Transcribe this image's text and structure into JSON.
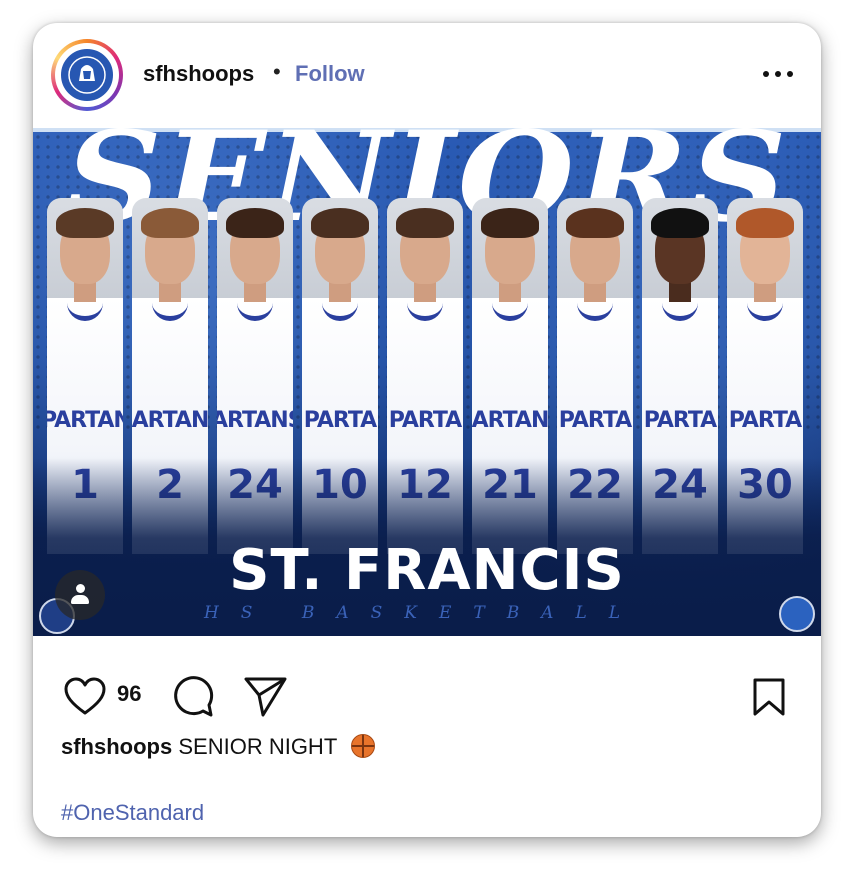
{
  "header": {
    "username": "sfhshoops",
    "separator": "•",
    "follow_label": "Follow",
    "avatar_icon": "team-logo",
    "more_icon": "more-horizontal-icon"
  },
  "image": {
    "headline": "SENIORS",
    "school_name": "ST. FRANCIS",
    "subtitle": "HS BASKETBALL",
    "players": [
      {
        "team": "PARTAN",
        "number": "1"
      },
      {
        "team": "ARTAN",
        "number": "2"
      },
      {
        "team": "ARTANS",
        "number": "24"
      },
      {
        "team": "PARTA",
        "number": "10"
      },
      {
        "team": "PARTA",
        "number": "12"
      },
      {
        "team": "ARTAN",
        "number": "21"
      },
      {
        "team": "PARTA",
        "number": "22"
      },
      {
        "team": "PARTA",
        "number": "24"
      },
      {
        "team": "PARTA",
        "number": "30"
      }
    ],
    "colors": {
      "primary": "#1e4b9f",
      "dark": "#0a1d4a",
      "jersey_text": "#2a3f9e"
    }
  },
  "actions": {
    "like_count": "96",
    "like_icon": "heart-icon",
    "comment_icon": "comment-icon",
    "share_icon": "send-icon",
    "save_icon": "bookmark-icon"
  },
  "caption": {
    "username": "sfhshoops",
    "text": "SENIOR NIGHT",
    "emoji": "basketball-icon",
    "hashtag": "#OneStandard"
  },
  "colors": {
    "link": "#5f6fb4",
    "hashtag": "#4f63ae"
  }
}
